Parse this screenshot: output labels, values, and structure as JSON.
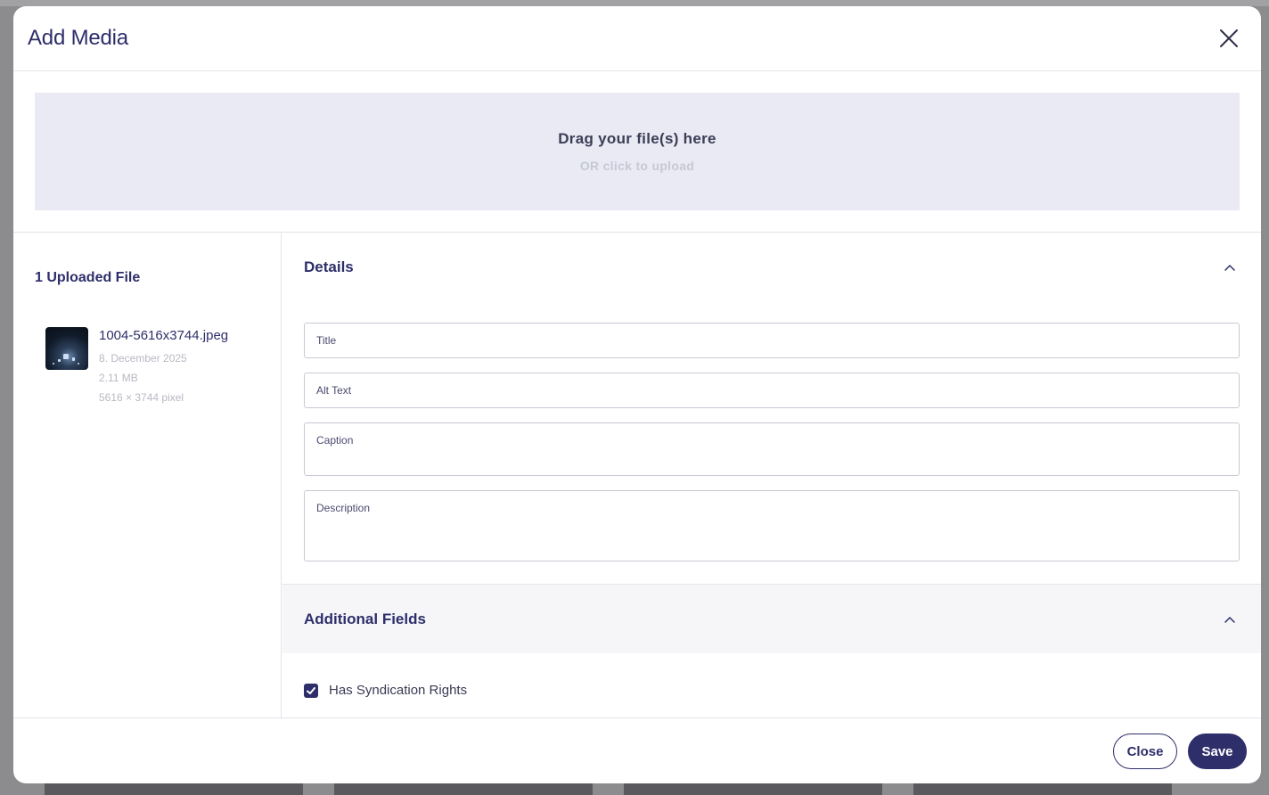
{
  "modal": {
    "title": "Add Media"
  },
  "dropzone": {
    "main_text": "Drag your file(s) here",
    "sub_text": "OR click to upload"
  },
  "uploaded": {
    "title": "1 Uploaded File",
    "files": [
      {
        "name": "1004-5616x3744.jpeg",
        "date": "8. December 2025",
        "size": "2.11 MB",
        "dimensions": "5616 × 3744 pixel"
      }
    ]
  },
  "details": {
    "heading": "Details",
    "fields": {
      "title": "Title",
      "alt_text": "Alt Text",
      "caption": "Caption",
      "description": "Description"
    }
  },
  "additional_fields": {
    "heading": "Additional Fields",
    "syndication_label": "Has Syndication Rights",
    "syndication_checked": true
  },
  "footer": {
    "close_label": "Close",
    "save_label": "Save"
  },
  "colors": {
    "accent": "#2e2e6a",
    "dropzone_bg": "#e9eaf4"
  }
}
